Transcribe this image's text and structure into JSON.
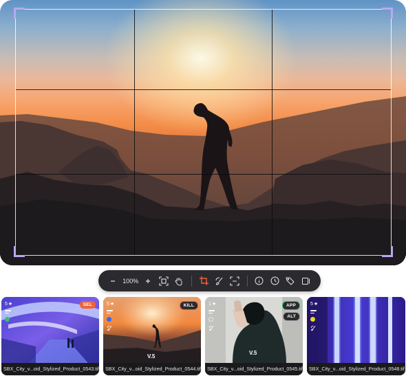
{
  "viewer": {
    "image_description_icon": "sunset-silhouette-photo"
  },
  "toolbar": {
    "zoom_out_icon": "minus-icon",
    "zoom_level": "100%",
    "zoom_in_icon": "plus-icon",
    "fit_icon": "fit-screen-icon",
    "pan_icon": "hand-icon",
    "crop_icon": "crop-icon",
    "retouch_icon": "brush-icon",
    "select_icon": "focus-frame-icon",
    "info_icon": "info-icon",
    "history_icon": "clock-icon",
    "tags_icon": "tag-icon",
    "compare_icon": "compare-icon",
    "accent": "#f0633a"
  },
  "thumbnails": [
    {
      "filename": "SBX_City_v...oid_Stylized_Product_0543.tif",
      "rating": "5",
      "badge": "SEL",
      "badge_color": "#f0633a",
      "dot_color": "#32c46a",
      "version": ""
    },
    {
      "filename": "SBX_City_v...oid_Stylized_Product_0544.tif",
      "rating": "5",
      "badge": "KILL",
      "badge_color": "#3a3a3e",
      "dot_color": "#2f6ff0",
      "version": "V.5"
    },
    {
      "filename": "SBX_City_v...oid_Stylized_Product_0545.tif",
      "rating": "1",
      "badge": "APP",
      "badge2": "ALT",
      "badge_color": "#3a3a3e",
      "dot_color": "",
      "version": "V.5"
    },
    {
      "filename": "SBX_City_v...oid_Stylized_Product_0548.tif",
      "rating": "5",
      "badge": "",
      "badge_color": "",
      "dot_color": "#f2d41a",
      "version": ""
    }
  ]
}
